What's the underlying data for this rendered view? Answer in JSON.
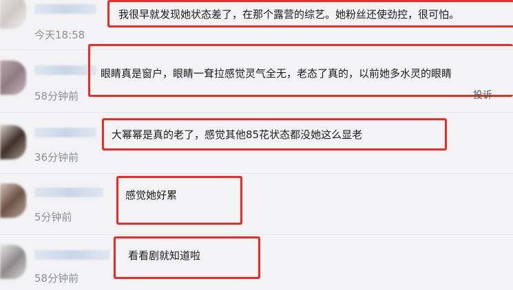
{
  "comments": [
    {
      "time": "今天18:58",
      "text": "我很早就发现她状态差了，在那个露营的综艺。她粉丝还使劲控，很可怕。"
    },
    {
      "time": "58分钟前",
      "text": "眼睛真是窗户，眼睛一耷拉感觉灵气全无，老态了真的，以前她多水灵的眼睛",
      "report": "投诉"
    },
    {
      "time": "36分钟前",
      "text": "大幂幂是真的老了，感觉其他85花状态都没她这么显老"
    },
    {
      "time": "5分钟前",
      "text": "感觉她好累"
    },
    {
      "time": "58分钟前",
      "text": "看看剧就知道啦"
    }
  ],
  "colors": {
    "highlight_box": "#ee2a24",
    "timestamp": "#8a8f99",
    "background": "#f3f3f5"
  }
}
